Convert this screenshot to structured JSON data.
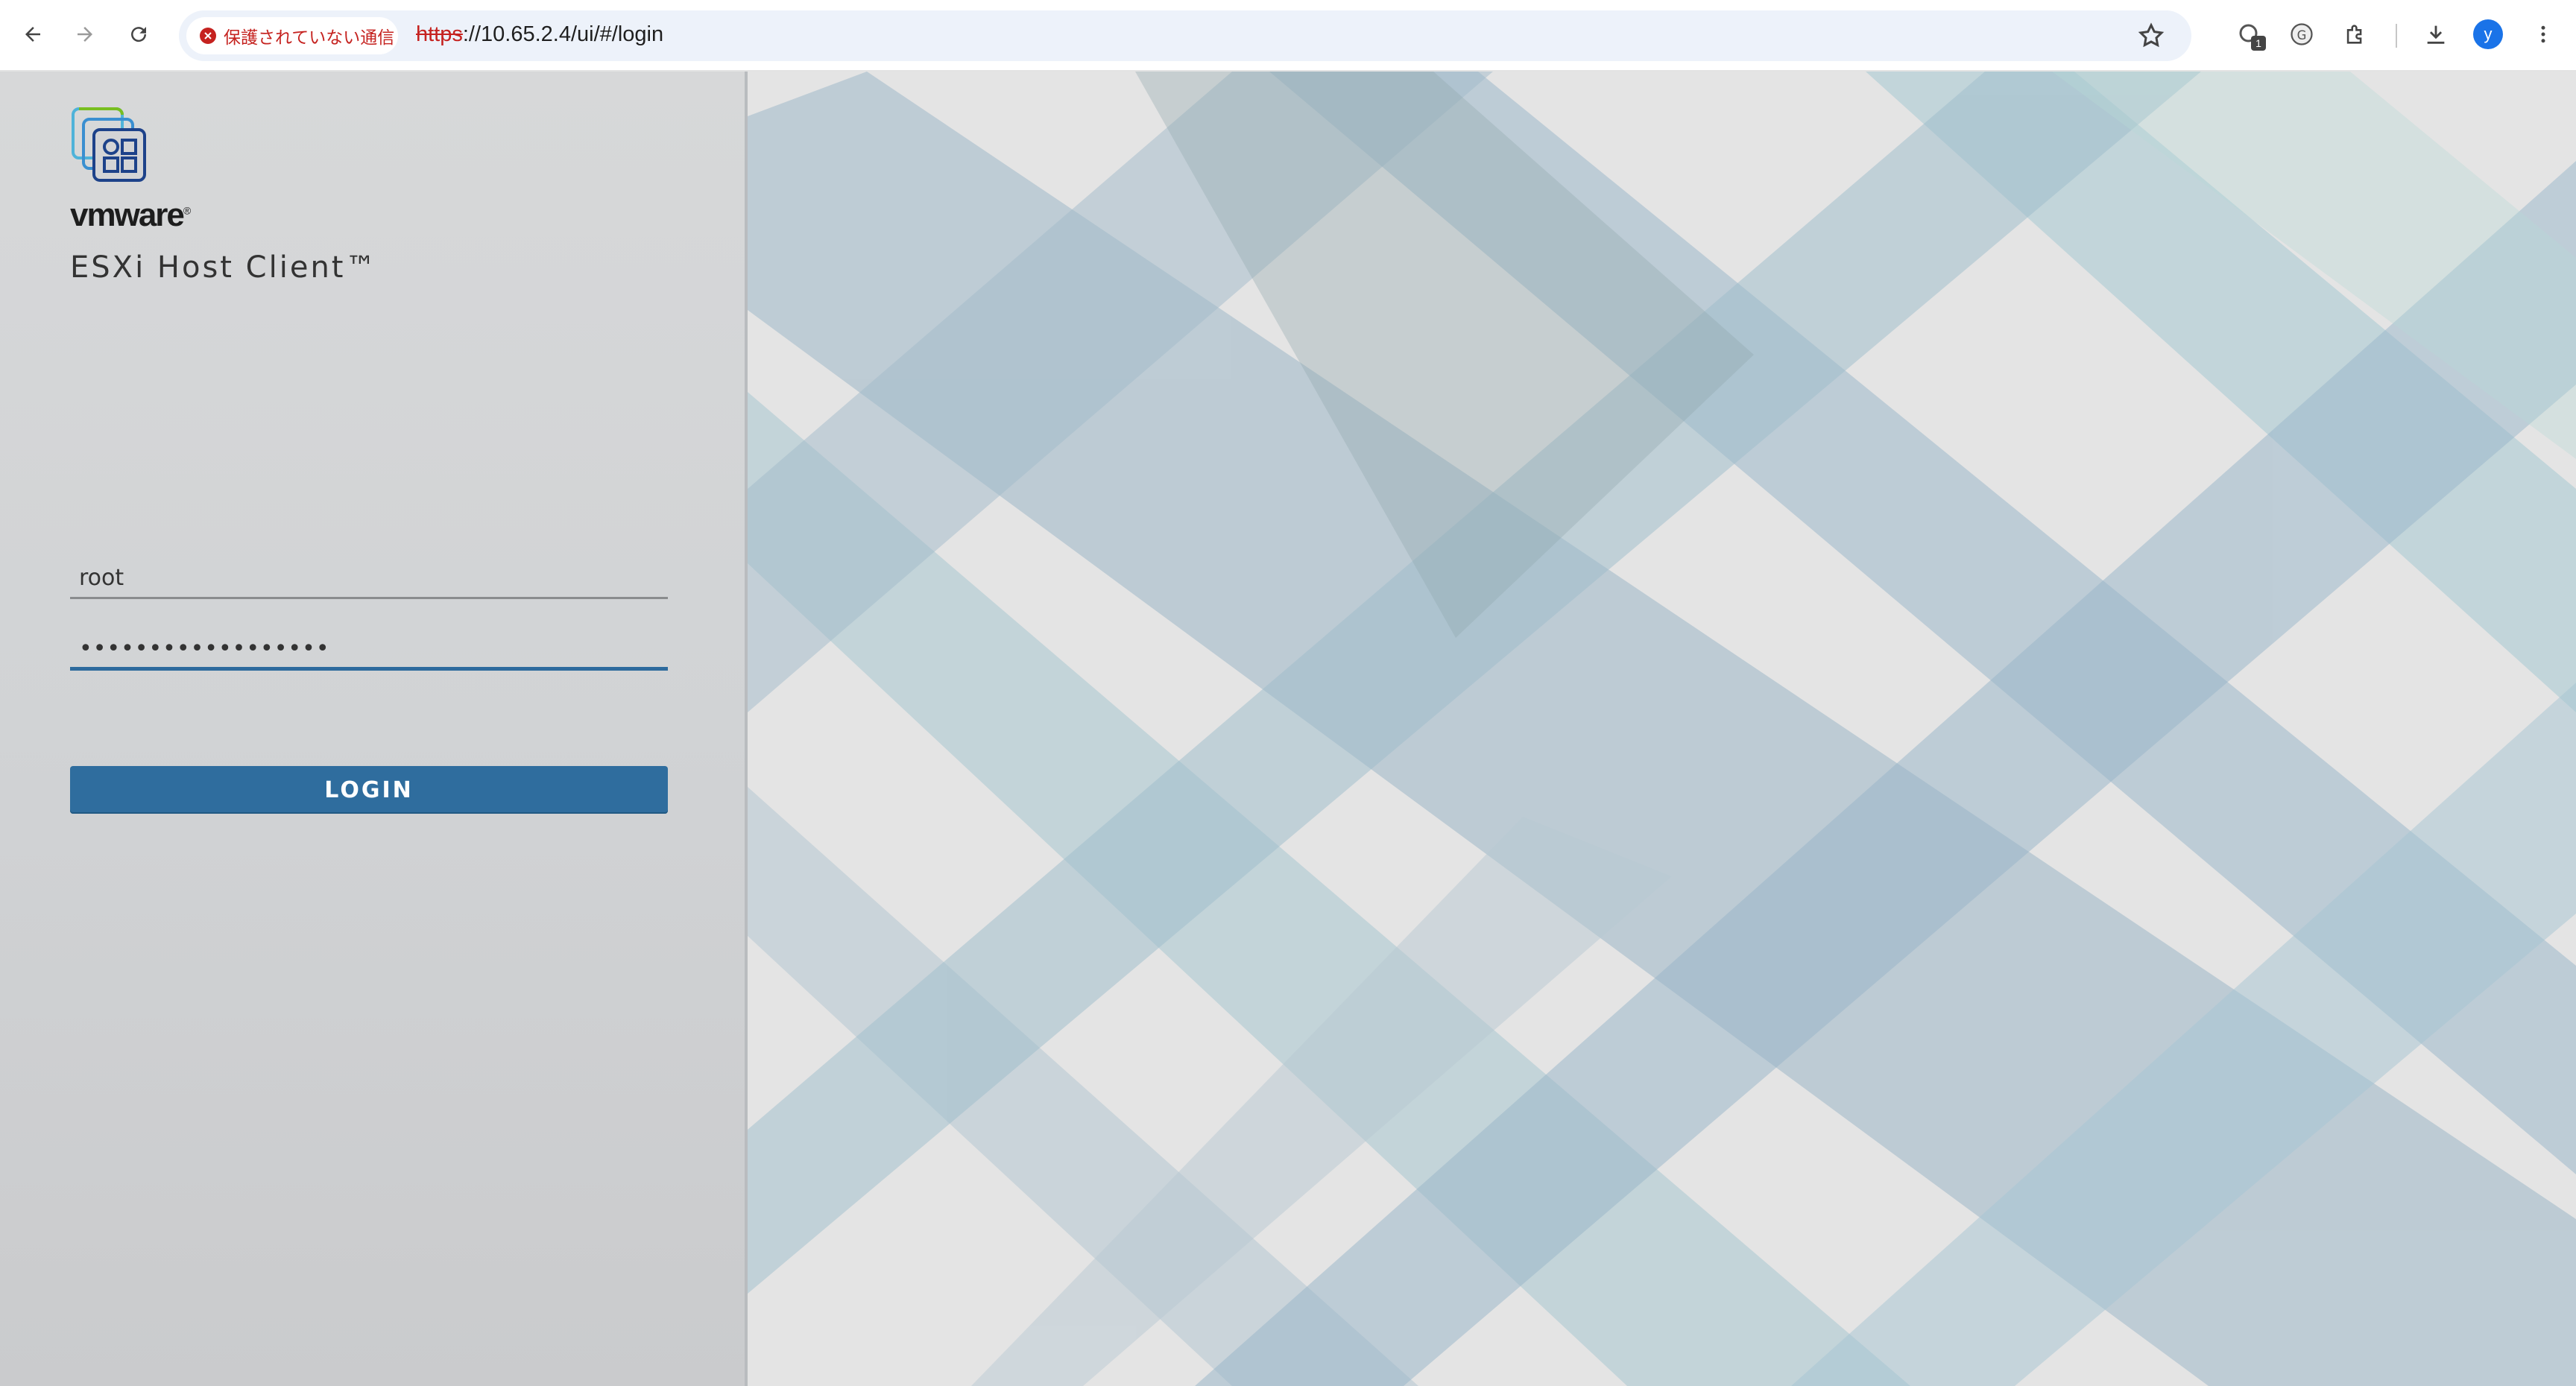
{
  "browser": {
    "security_label": "保護されていない通信",
    "url_scheme": "https",
    "url_rest": "://10.65.2.4/ui/#/login",
    "extension_badge": "1",
    "profile_initial": "y"
  },
  "login": {
    "brand": "vmware",
    "product_name": "ESXi Host Client™",
    "username_value": "root",
    "password_value": "••••••••••••••••••",
    "button_label": "LOGIN"
  },
  "colors": {
    "button": "#2f6d9e",
    "panel": "#d3d4d6",
    "insecure": "#c5221f"
  }
}
